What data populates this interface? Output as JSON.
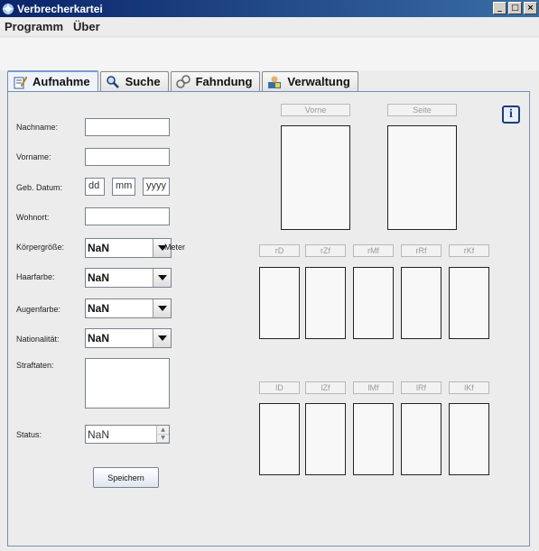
{
  "window": {
    "title": "Verbrecherkartei",
    "buttons": [
      "_",
      "□",
      "×"
    ]
  },
  "menu": [
    "Programm",
    "Über"
  ],
  "tabs": [
    {
      "label": "Aufnahme",
      "icon": "edit-icon",
      "active": true
    },
    {
      "label": "Suche",
      "icon": "search-icon"
    },
    {
      "label": "Fahndung",
      "icon": "handcuffs-icon"
    },
    {
      "label": "Verwaltung",
      "icon": "admin-icon"
    }
  ],
  "form": {
    "nachname_label": "Nachname:",
    "vorname_label": "Vorname:",
    "geb_label": "Geb. Datum:",
    "dd": "dd",
    "mm": "mm",
    "yyyy": "yyyy",
    "wohnort_label": "Wohnort:",
    "koerper_label": "Körpergröße:",
    "koerper_value": "NaN",
    "meter_label": "Meter",
    "haar_label": "Haarfarbe:",
    "haar_value": "NaN",
    "augen_label": "Augenfarbe:",
    "augen_value": "NaN",
    "nation_label": "Nationalität:",
    "nation_value": "NaN",
    "straftaten_label": "Straftaten:",
    "status_label": "Status:",
    "status_value": "NaN",
    "save_label": "Speichern"
  },
  "photos": {
    "vorne": "Vorne",
    "seite": "Seite",
    "right_hand": [
      "rD",
      "rZf",
      "rMf",
      "rRf",
      "rKf"
    ],
    "left_hand": [
      "lD",
      "lZf",
      "lMf",
      "lRf",
      "lKf"
    ]
  },
  "info_icon": "i",
  "colors": {
    "titlebar": "#0a246a",
    "tab_active": "#eef3fa",
    "panel_border": "#7a8db0"
  }
}
